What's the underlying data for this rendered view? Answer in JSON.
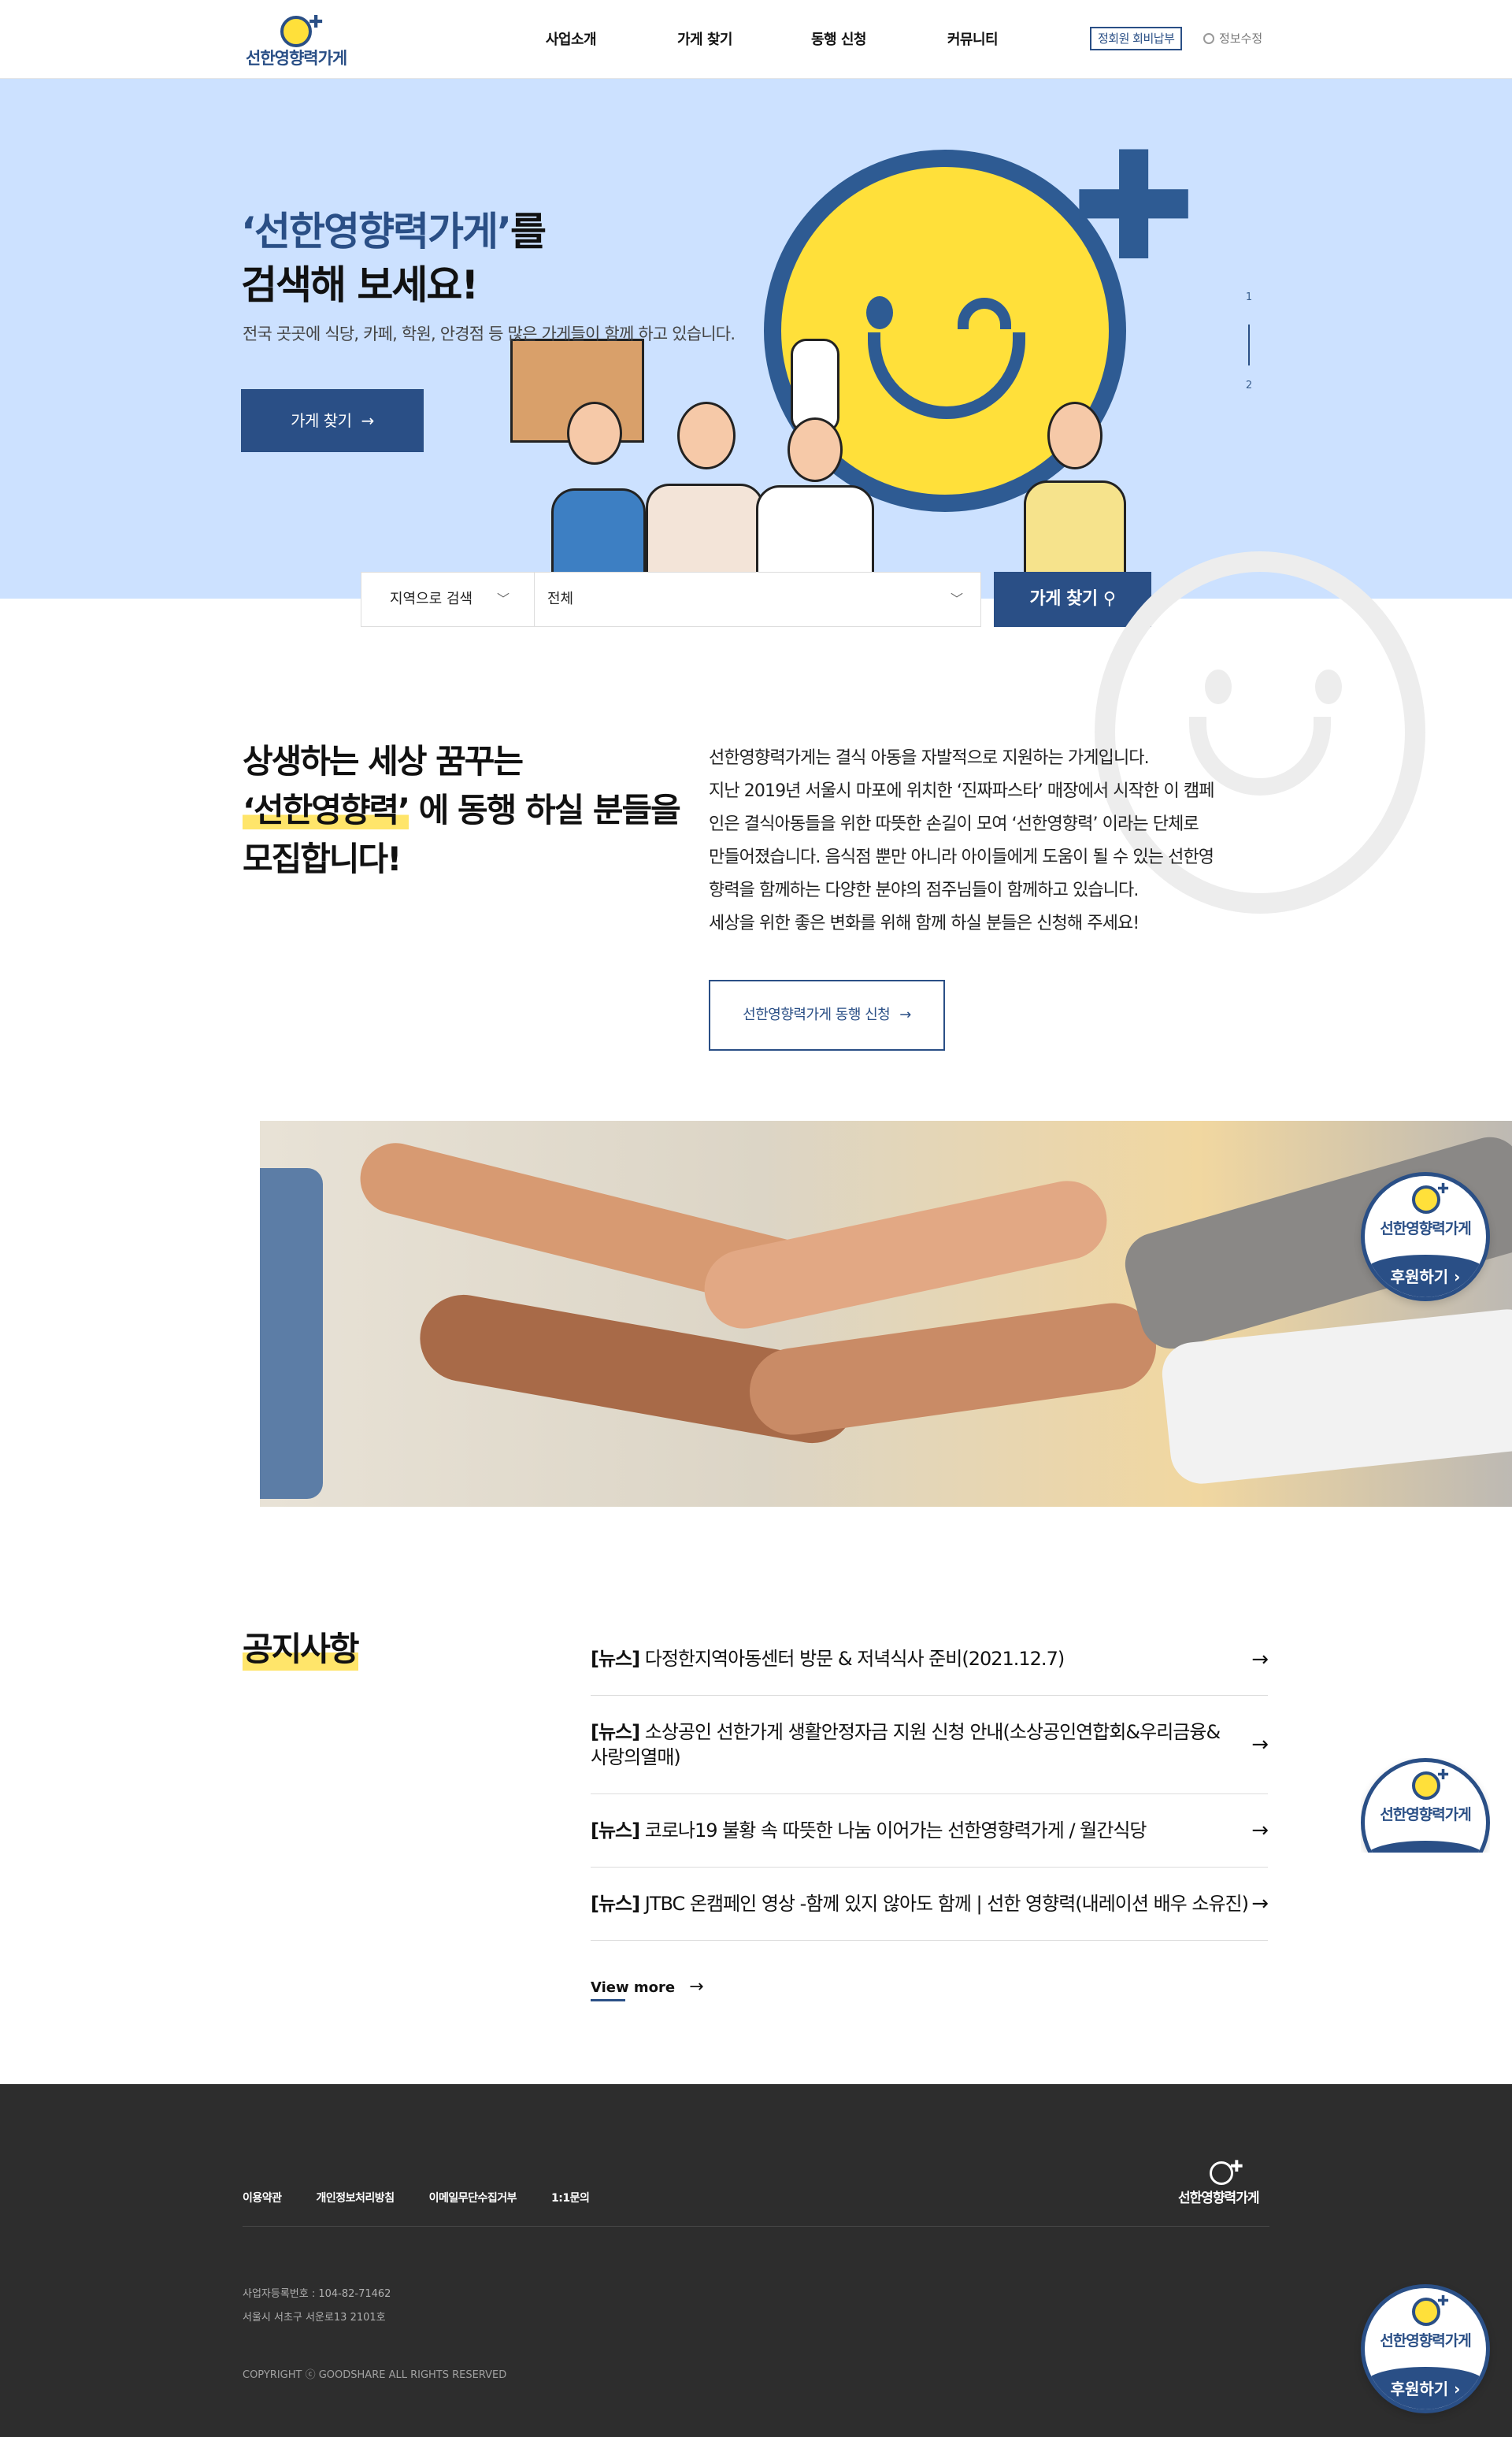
{
  "header": {
    "logo_text": "선한영향력가게",
    "nav": [
      "사업소개",
      "가게 찾기",
      "동행 신청",
      "커뮤니티"
    ],
    "member_btn": "정회원 회비납부",
    "edit_info": "정보수정"
  },
  "hero": {
    "title_hl": "‘선한영향력가게’",
    "title_rest": "를",
    "title_line2": "검색해 보세요!",
    "subtitle": "전국 곳곳에 식당, 카페, 학원, 안경점 등 많은 가게들이 함께 하고 있습니다.",
    "button": "가게 찾기",
    "arrow": "→",
    "slide_1": "1",
    "slide_2": "2"
  },
  "search": {
    "region_label": "지역으로 검색",
    "region_value": "전체",
    "button": "가게 찾기"
  },
  "intro": {
    "title_l1": "상생하는 세상 꿈꾸는",
    "title_hl": "‘선한영향력’",
    "title_l2_rest": " 에 동행 하실 분들을",
    "title_l3": "모집합니다!",
    "text": [
      "선한영향력가게는 결식 아동을 자발적으로 지원하는 가게입니다.",
      "지난 2019년 서울시 마포에 위치한 ‘진짜파스타’ 매장에서 시작한 이 캠페",
      "인은 결식아동들을 위한 따뜻한 손길이 모여 ‘선한영향력’ 이라는 단체로",
      "만들어졌습니다. 음식점 뿐만 아니라 아이들에게 도움이 될 수 있는 선한영",
      "향력을 함께하는 다양한 분야의 점주님들이 함께하고 있습니다.",
      "세상을 위한 좋은 변화를 위해 함께 하실 분들은 신청해 주세요!"
    ],
    "cta": "선한영향력가게 동행 신청"
  },
  "notices": {
    "title": "공지사항",
    "items": [
      {
        "tag": "[뉴스]",
        "text": " 다정한지역아동센터 방문 & 저녁식사 준비(2021.12.7)"
      },
      {
        "tag": "[뉴스]",
        "text": " 소상공인 선한가게 생활안정자금 지원 신청 안내(소상공인연합회&우리금융&사랑의열매)"
      },
      {
        "tag": "[뉴스]",
        "text": " 코로나19 불황 속 따뜻한 나눔 이어가는 선한영향력가게 / 월간식당"
      },
      {
        "tag": "[뉴스]",
        "text": " JTBC 온캠페인 영상 -함께 있지 않아도 함께 | 선한 영향력(내레이션 배우 소유진)"
      }
    ],
    "arrow": "→",
    "view_more": "View more"
  },
  "footer": {
    "links": [
      "이용약관",
      "개인정보처리방침",
      "이메일무단수집거부",
      "1:1문의"
    ],
    "logo_text": "선한영향력가게",
    "biz_no": "사업자등록번호 : 104-82-71462",
    "address": "서울시 서초구 서운로13 2101호",
    "copyright": "COPYRIGHT ⓒ GOODSHARE ALL RIGHTS RESERVED"
  },
  "badge": {
    "logo_text": "선한영향력가게",
    "button": "후원하기 ›"
  },
  "colors": {
    "brand_blue": "#2a4f86",
    "hero_bg": "#cce1ff",
    "accent_yellow": "#ffe03a",
    "footer_bg": "#2d2d2d"
  }
}
